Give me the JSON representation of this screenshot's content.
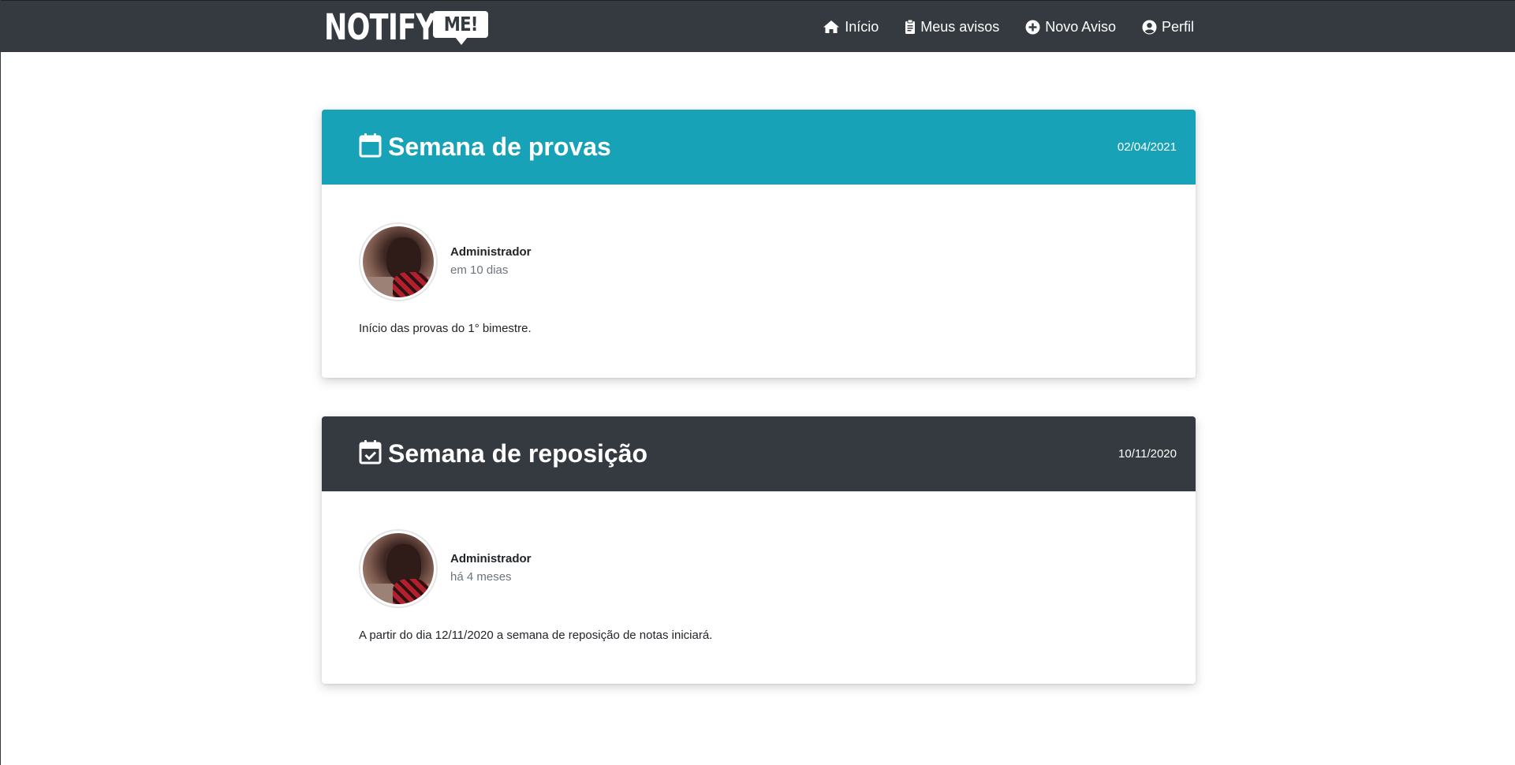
{
  "brand": {
    "word": "NOTIFY",
    "bubble": "ME!"
  },
  "nav": [
    {
      "label": "Início",
      "icon": "home-icon"
    },
    {
      "label": "Meus avisos",
      "icon": "clipboard-icon"
    },
    {
      "label": "Novo Aviso",
      "icon": "plus-circle-icon"
    },
    {
      "label": "Perfil",
      "icon": "user-circle-icon"
    }
  ],
  "colors": {
    "navbar": "#343a40",
    "info": "#17a2b8",
    "dark": "#343a40"
  },
  "notices": [
    {
      "title": "Semana de provas",
      "icon": "calendar-icon",
      "date": "02/04/2021",
      "author": "Administrador",
      "relative_time": "em 10 dias",
      "text": "Início das provas do 1° bimestre."
    },
    {
      "title": "Semana de reposição",
      "icon": "calendar-check-icon",
      "date": "10/11/2020",
      "author": "Administrador",
      "relative_time": "há 4 meses",
      "text": "A partir do dia 12/11/2020 a semana de reposição de notas iniciará."
    }
  ]
}
